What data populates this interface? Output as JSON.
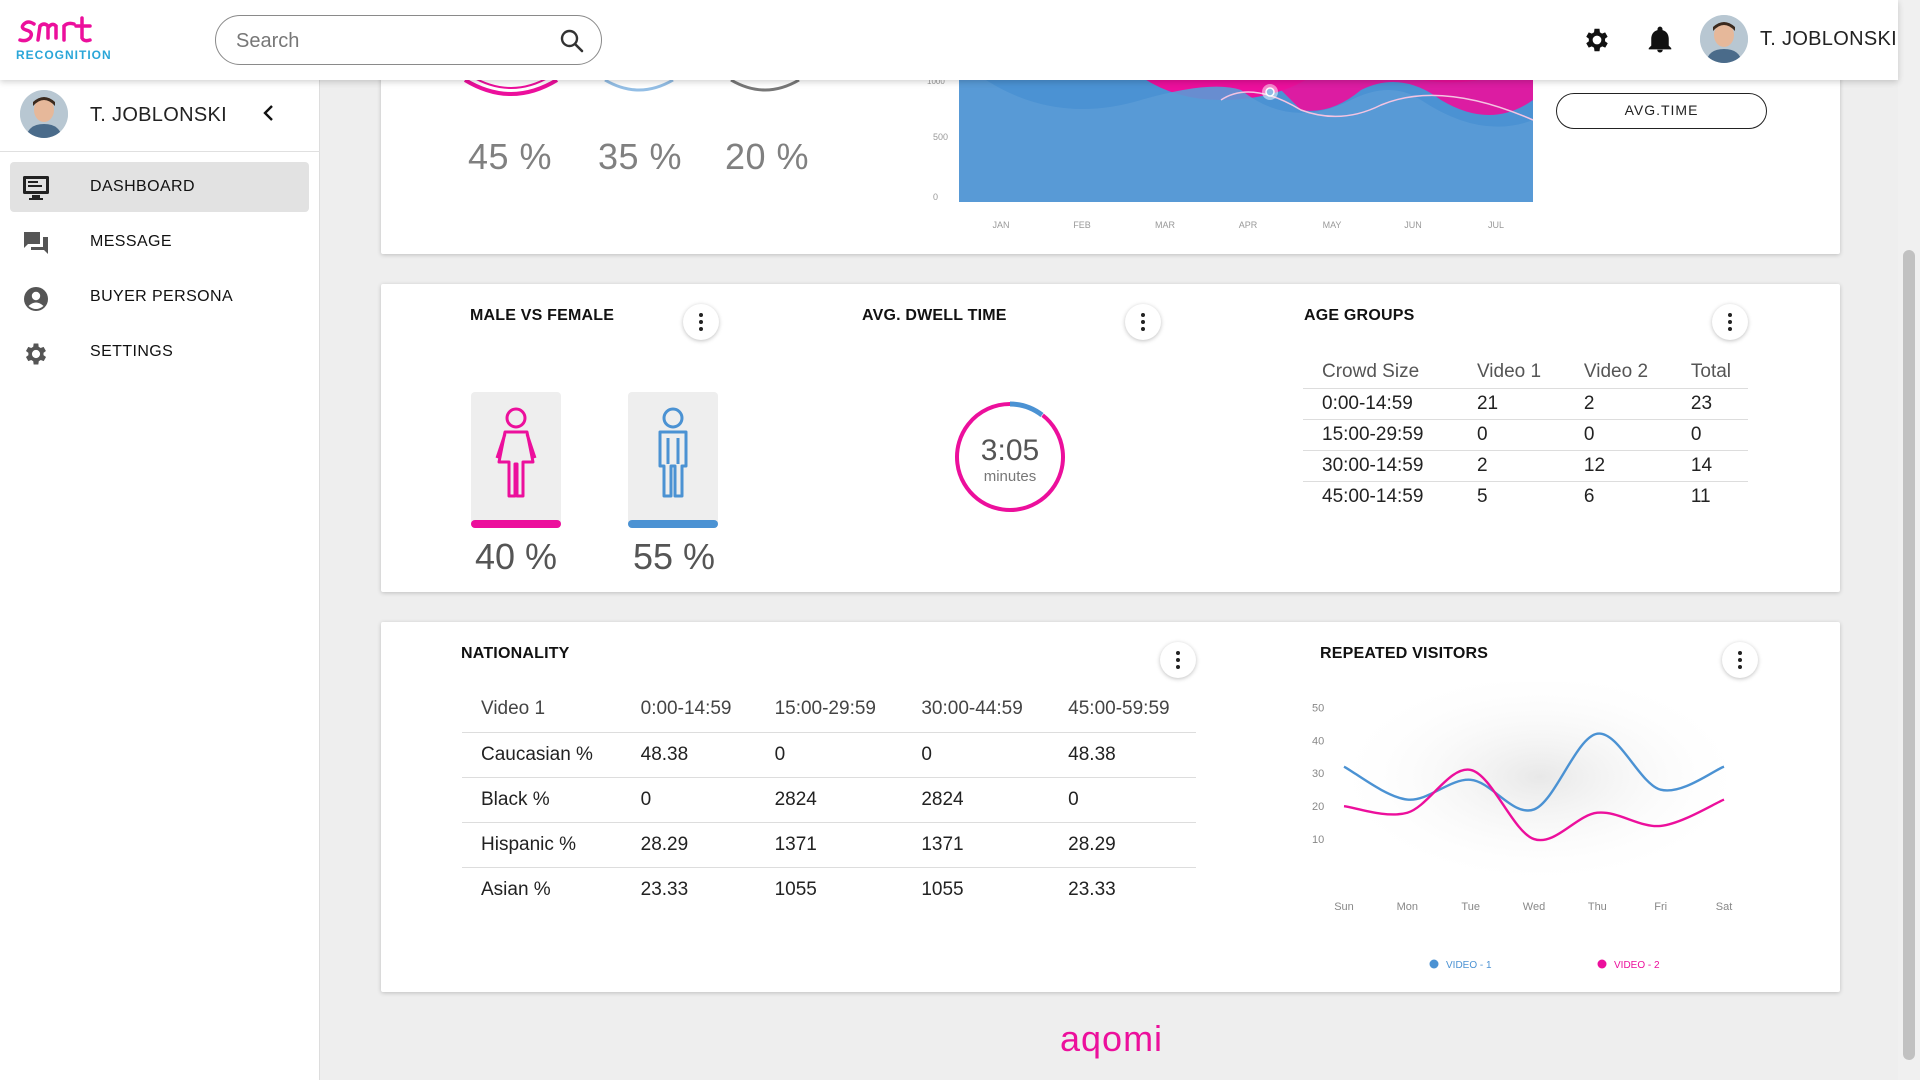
{
  "app": {
    "logo_word": "smrt",
    "logo_sub": "RECOGNITION"
  },
  "search": {
    "placeholder": "Search"
  },
  "user": {
    "name": "T. JOBLONSKI"
  },
  "sidebar": {
    "user_name": "T. JOBLONSKI",
    "items": [
      {
        "label": "DASHBOARD",
        "icon": "monitor-icon",
        "active": true
      },
      {
        "label": "MESSAGE",
        "icon": "chat-icon"
      },
      {
        "label": "BUYER PERSONA",
        "icon": "account-circle-icon"
      },
      {
        "label": "SETTINGS",
        "icon": "gear-icon"
      }
    ]
  },
  "top_card": {
    "percents": [
      "45 %",
      "35 %",
      "20 %"
    ],
    "avg_time_button": "AVG.TIME",
    "area_chart": {
      "y_ticks": [
        "1000",
        "500",
        "0"
      ],
      "x_labels": [
        "JAN",
        "FEB",
        "MAR",
        "APR",
        "MAY",
        "JUN",
        "JUL"
      ]
    }
  },
  "male_female": {
    "title": "MALE VS FEMALE",
    "female_pct": "40 %",
    "male_pct": "55 %",
    "colors": {
      "female": "#ec0f9c",
      "male": "#4b92d3"
    }
  },
  "dwell": {
    "title": "AVG. DWELL TIME",
    "time": "3:05",
    "unit": "minutes"
  },
  "age_groups": {
    "title": "AGE GROUPS",
    "headers": [
      "Crowd Size",
      "Video 1",
      "Video 2",
      "Total"
    ],
    "rows": [
      [
        "0:00-14:59",
        "21",
        "2",
        "23"
      ],
      [
        "15:00-29:59",
        "0",
        "0",
        "0"
      ],
      [
        "30:00-14:59",
        "2",
        "12",
        "14"
      ],
      [
        "45:00-14:59",
        "5",
        "6",
        "11"
      ]
    ]
  },
  "nationality": {
    "title": "NATIONALITY",
    "headers": [
      "Video 1",
      "0:00-14:59",
      "15:00-29:59",
      "30:00-44:59",
      "45:00-59:59"
    ],
    "rows": [
      [
        "Caucasian %",
        "48.38",
        "0",
        "0",
        "48.38"
      ],
      [
        "Black %",
        "0",
        "2824",
        "2824",
        "0"
      ],
      [
        "Hispanic %",
        "28.29",
        "1371",
        "1371",
        "28.29"
      ],
      [
        "Asian %",
        "23.33",
        "1055",
        "1055",
        "23.33"
      ]
    ]
  },
  "repeated": {
    "title": "REPEATED VISITORS",
    "chart_data": {
      "type": "line",
      "categories": [
        "Sun",
        "Mon",
        "Tue",
        "Wed",
        "Thu",
        "Fri",
        "Sat"
      ],
      "y_ticks": [
        "50",
        "40",
        "30",
        "20",
        "10"
      ],
      "ylim": [
        0,
        50
      ],
      "series": [
        {
          "name": "VIDEO - 1",
          "color": "#4b92d3",
          "values": [
            32,
            22,
            28,
            19,
            42,
            25,
            32
          ]
        },
        {
          "name": "VIDEO - 2",
          "color": "#ec0f9c",
          "values": [
            20,
            18,
            31,
            10,
            18,
            14,
            22
          ]
        }
      ]
    }
  },
  "footer": {
    "brand": "aqomi"
  }
}
